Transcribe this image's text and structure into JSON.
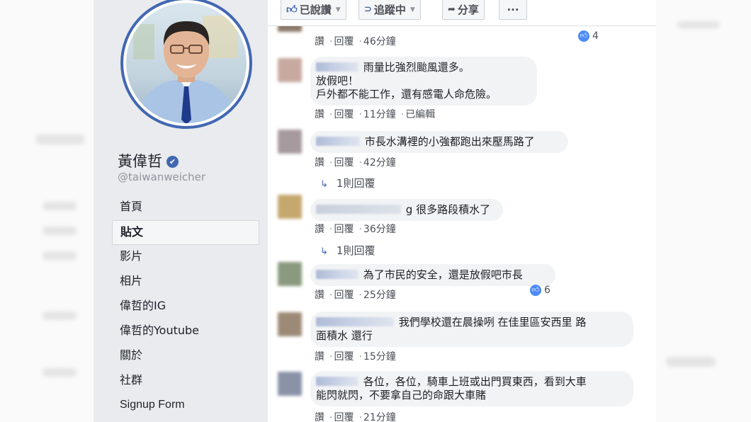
{
  "topbar": {
    "liked_label": "已說讚",
    "following_label": "追蹤中",
    "share_label": "分享",
    "more_label": "···"
  },
  "page": {
    "name": "黃偉哲",
    "handle": "@taiwanweicher"
  },
  "nav": [
    {
      "label": "首頁",
      "active": false
    },
    {
      "label": "貼文",
      "active": true
    },
    {
      "label": "影片",
      "active": false
    },
    {
      "label": "相片",
      "active": false
    },
    {
      "label": "偉哲的IG",
      "active": false
    },
    {
      "label": "偉哲的Youtube",
      "active": false
    },
    {
      "label": "關於",
      "active": false
    },
    {
      "label": "社群",
      "active": false
    },
    {
      "label": "Signup Form",
      "active": false
    }
  ],
  "actions": {
    "like": "讚",
    "reply": "回覆",
    "edited": "已編輯"
  },
  "comments": [
    {
      "time": "46分鐘",
      "reactions": "4"
    },
    {
      "lines": [
        "雨量比強烈颱風還多。",
        "放假吧！",
        "戶外都不能工作，還有感電人命危險。"
      ],
      "time": "11分鐘",
      "edited": true
    },
    {
      "lines": [
        "市長水溝裡的小強都跑出來壓馬路了"
      ],
      "time": "42分鐘",
      "replies": "1則回覆"
    },
    {
      "lines": [
        "g 很多路段積水了"
      ],
      "time": "36分鐘",
      "replies": "1則回覆"
    },
    {
      "lines": [
        "為了市民的安全，還是放假吧市長"
      ],
      "time": "25分鐘",
      "reactions": "6"
    },
    {
      "lines": [
        "我們學校還在晨操咧 在佳里區安西里 路",
        "面積水 還行"
      ],
      "time": "15分鐘"
    },
    {
      "lines": [
        "各位，各位，騎車上班或出門買東西，看到大車",
        "能閃就閃，不要拿自己的命跟大車賭"
      ],
      "time": "21分鐘"
    }
  ],
  "colors": {
    "brand": "#4267b2",
    "sidebar_bg": "#e9ebee",
    "bubble_bg": "#f2f3f5",
    "like_blue": "#4c8bf5"
  }
}
